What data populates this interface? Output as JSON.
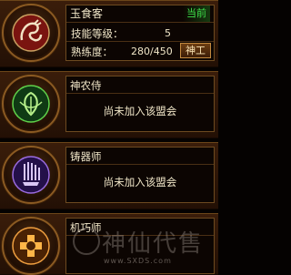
{
  "profession": {
    "name": "玉食客",
    "status": "当前",
    "skill_level_label": "技能等级：",
    "skill_level_value": "5",
    "proficiency_label": "熟练度：",
    "proficiency_value": "280/450",
    "proficiency_fraction": 0.622,
    "button_label": "神工",
    "icon": "dragon-emblem-icon"
  },
  "guilds": [
    {
      "title": "神农侍",
      "status": "尚未加入该盟会",
      "icon": "leaf-emblem-icon",
      "accent": "#2f8a2a"
    },
    {
      "title": "铸器师",
      "status": "尚未加入该盟会",
      "icon": "tools-emblem-icon",
      "accent": "#6a3cc2"
    },
    {
      "title": "机巧师",
      "status": "",
      "icon": "gear-emblem-icon",
      "accent": "#d07a18"
    }
  ],
  "watermark": {
    "text": "神仙代售",
    "url": "www.SXDS.com"
  },
  "colors": {
    "text": "#f0e6c8",
    "current_status": "#3ee04a",
    "panel_border": "#6b4519"
  }
}
